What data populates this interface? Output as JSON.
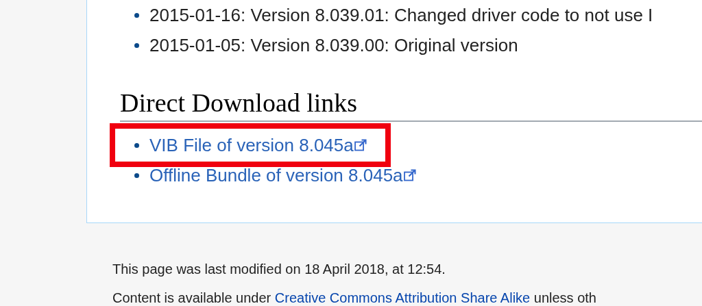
{
  "history_items": [
    "2015-01-16: Version 8.039.01: Changed driver code to not use I",
    "2015-01-05: Version 8.039.00: Original version"
  ],
  "section_heading": "Direct Download links",
  "download_links": [
    {
      "label": "VIB File of version 8.045a",
      "highlighted": true
    },
    {
      "label": "Offline Bundle of version 8.045a",
      "highlighted": false
    }
  ],
  "footer": {
    "last_modified": "This page was last modified on 18 April 2018, at 12:54.",
    "license_prefix": "Content is available under",
    "license_link": "Creative Commons Attribution Share Alike",
    "license_suffix": "unless oth"
  }
}
